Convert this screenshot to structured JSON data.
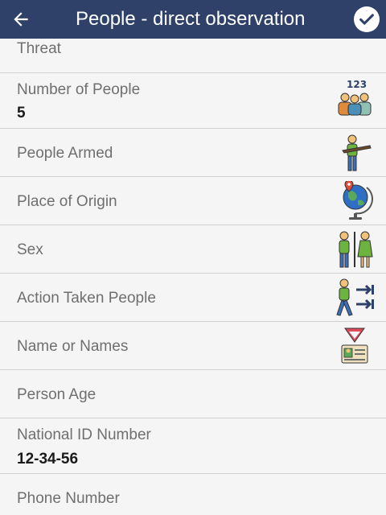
{
  "appbar": {
    "title": "People - direct observation",
    "back_icon": "arrow-left-icon",
    "confirm_icon": "check-circle-icon"
  },
  "fields": [
    {
      "label": "Threat"
    },
    {
      "label": "Number of People",
      "value": "5",
      "icon": "people-count-icon",
      "icon_text": "123"
    },
    {
      "label": "People Armed",
      "icon": "armed-person-icon"
    },
    {
      "label": "Place of Origin",
      "icon": "globe-pin-icon"
    },
    {
      "label": "Sex",
      "icon": "male-female-icon"
    },
    {
      "label": "Action Taken People",
      "icon": "walking-person-arrows-icon"
    },
    {
      "label": "Name or Names",
      "icon": "id-badge-icon"
    },
    {
      "label": "Person Age"
    },
    {
      "label": "National ID Number",
      "value": "12-34-56"
    },
    {
      "label": "Phone Number"
    }
  ],
  "colors": {
    "appbar": "#2f4168",
    "background": "#f5f5f5",
    "divider": "#d0d0d0",
    "label": "#6f6f6f",
    "value": "#1a1a1a"
  }
}
